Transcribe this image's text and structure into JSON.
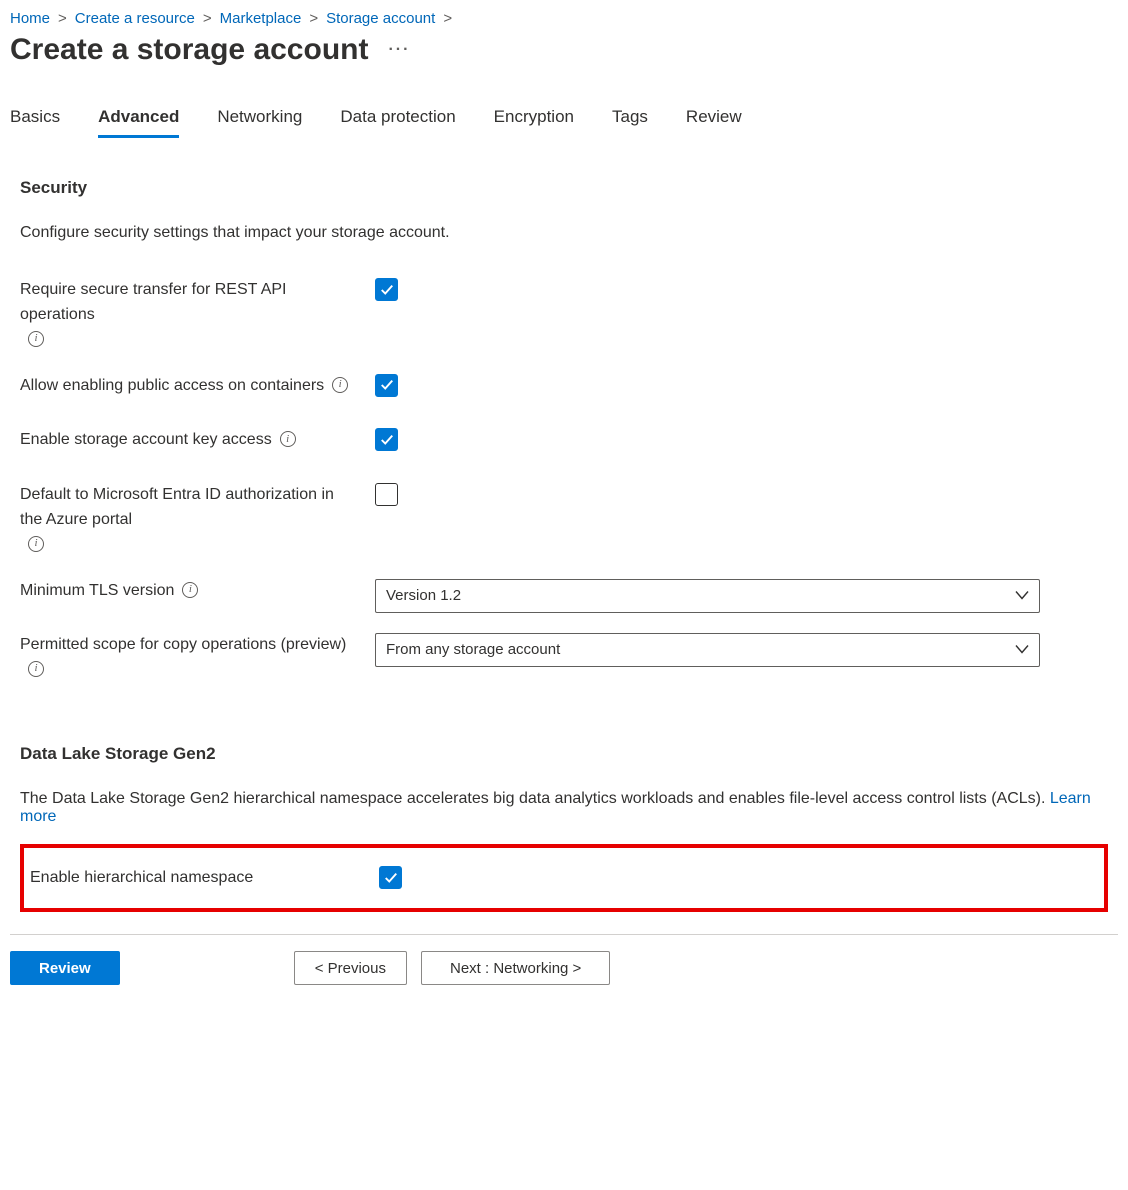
{
  "breadcrumb": [
    {
      "label": "Home"
    },
    {
      "label": "Create a resource"
    },
    {
      "label": "Marketplace"
    },
    {
      "label": "Storage account"
    }
  ],
  "page_title": "Create a storage account",
  "tabs": [
    {
      "label": "Basics",
      "active": false
    },
    {
      "label": "Advanced",
      "active": true
    },
    {
      "label": "Networking",
      "active": false
    },
    {
      "label": "Data protection",
      "active": false
    },
    {
      "label": "Encryption",
      "active": false
    },
    {
      "label": "Tags",
      "active": false
    },
    {
      "label": "Review",
      "active": false
    }
  ],
  "security": {
    "heading": "Security",
    "desc": "Configure security settings that impact your storage account.",
    "require_secure": {
      "label": "Require secure transfer for REST API operations",
      "checked": true
    },
    "allow_public": {
      "label": "Allow enabling public access on containers",
      "checked": true
    },
    "key_access": {
      "label": "Enable storage account key access",
      "checked": true
    },
    "entra_default": {
      "label": "Default to Microsoft Entra ID authorization in the Azure portal",
      "checked": false
    },
    "tls": {
      "label": "Minimum TLS version",
      "value": "Version 1.2"
    },
    "copy_scope": {
      "label": "Permitted scope for copy operations (preview)",
      "value": "From any storage account"
    }
  },
  "datalake": {
    "heading": "Data Lake Storage Gen2",
    "desc": "The Data Lake Storage Gen2 hierarchical namespace accelerates big data analytics workloads and enables file-level access control lists (ACLs). ",
    "learn_more": "Learn more",
    "enable_hns": {
      "label": "Enable hierarchical namespace",
      "checked": true
    }
  },
  "footer": {
    "review": "Review",
    "previous": "<  Previous",
    "next": "Next : Networking  >"
  }
}
